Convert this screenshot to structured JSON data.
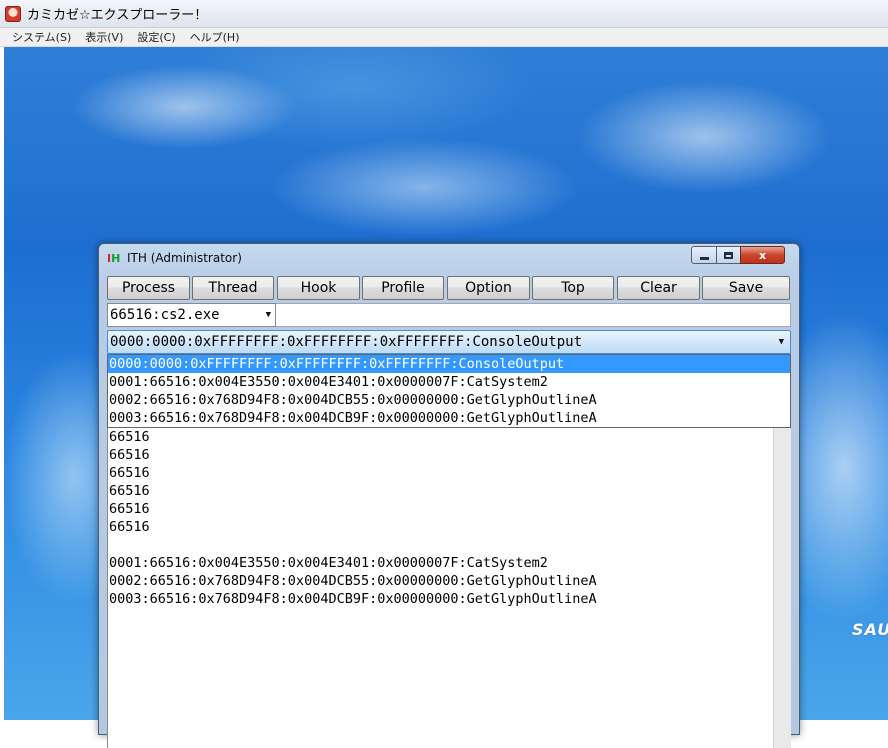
{
  "app": {
    "title": "カミカゼ☆エクスプローラー！",
    "menu": [
      "システム(S)",
      "表示(V)",
      "設定(C)",
      "ヘルプ(H)"
    ],
    "background_logo": "SAU"
  },
  "ith_window": {
    "title": "ITH (Administrator)",
    "icon_letters": [
      "I",
      "H"
    ],
    "toolbar": [
      "Process",
      "Thread",
      "Hook",
      "Profile",
      "Option",
      "Top",
      "Clear",
      "Save"
    ],
    "process_select": "66516:cs2.exe",
    "hook_select": "0000:0000:0xFFFFFFFF:0xFFFFFFFF:0xFFFFFFFF:ConsoleOutput",
    "hook_options": [
      "0000:0000:0xFFFFFFFF:0xFFFFFFFF:0xFFFFFFFF:ConsoleOutput",
      "0001:66516:0x004E3550:0x004E3401:0x0000007F:CatSystem2",
      "0002:66516:0x768D94F8:0x004DCB55:0x00000000:GetGlyphOutlineA",
      "0003:66516:0x768D94F8:0x004DCB9F:0x00000000:GetGlyphOutlineA"
    ],
    "selected_option_index": 0,
    "output_lines": [
      "66516",
      "66516",
      "66516",
      "66516",
      "66516",
      "66516",
      "",
      "0001:66516:0x004E3550:0x004E3401:0x0000007F:CatSystem2",
      "0002:66516:0x768D94F8:0x004DCB55:0x00000000:GetGlyphOutlineA",
      "0003:66516:0x768D94F8:0x004DCB9F:0x00000000:GetGlyphOutlineA"
    ],
    "close_glyph": "x"
  }
}
